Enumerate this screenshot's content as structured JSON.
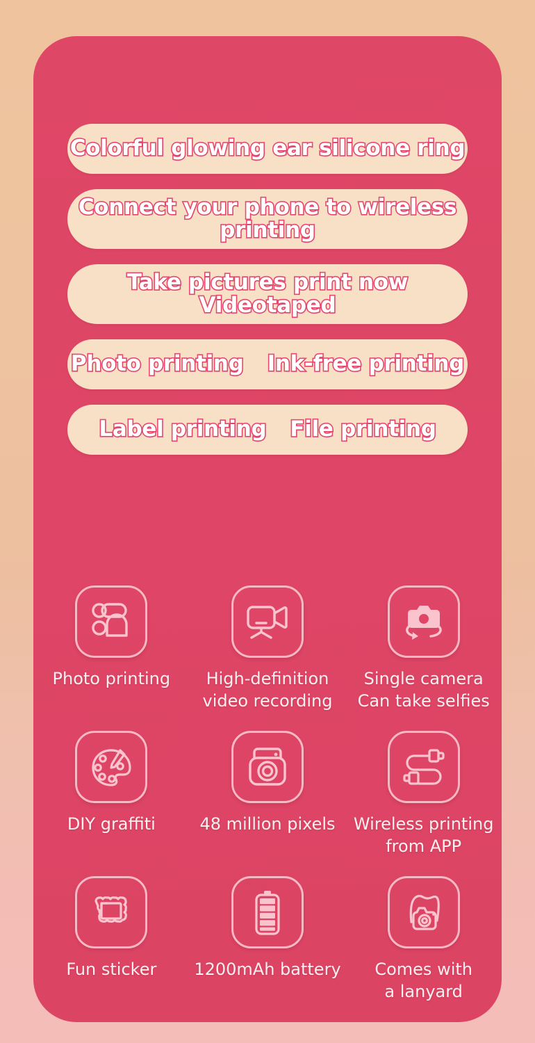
{
  "colors": {
    "page_background_top": "#eec39e",
    "page_background_bottom": "#f5bdb8",
    "card_background": "#de4566",
    "pill_background": "#f7e0c5",
    "pill_text_fill": "#ffffff",
    "pill_text_outline": "#e8486f",
    "icon_stroke": "#f6b9c4",
    "label_text": "#fdeef0"
  },
  "banners": [
    {
      "id": "colorful-glowing-ring",
      "text": "Colorful glowing ear silicone ring",
      "lines": 1
    },
    {
      "id": "wireless-printing",
      "text": "Connect your phone to wireless\nprinting",
      "lines": 2
    },
    {
      "id": "take-pictures-print-now",
      "text": "Take pictures print now\nVideotaped",
      "lines": 2
    },
    {
      "id": "photo-and-ink-free",
      "left": "Photo printing",
      "right": "Ink-free printing",
      "lines": 1
    },
    {
      "id": "label-and-file",
      "left": "Label printing",
      "right": "File printing",
      "lines": 1
    }
  ],
  "features": [
    {
      "icon": "photo-printing-icon",
      "label": "Photo printing"
    },
    {
      "icon": "video-camera-icon",
      "label": "High-definition\nvideo recording"
    },
    {
      "icon": "rotating-camera-icon",
      "label": "Single camera\nCan take selfies"
    },
    {
      "icon": "paint-palette-icon",
      "label": "DIY graffiti"
    },
    {
      "icon": "instant-camera-icon",
      "label": "48 million pixels"
    },
    {
      "icon": "usb-cable-icon",
      "label": "Wireless printing\nfrom APP"
    },
    {
      "icon": "sticker-frame-icon",
      "label": "Fun sticker"
    },
    {
      "icon": "battery-icon",
      "label": "1200mAh battery"
    },
    {
      "icon": "camera-lanyard-icon",
      "label": "Comes with\na lanyard"
    }
  ]
}
